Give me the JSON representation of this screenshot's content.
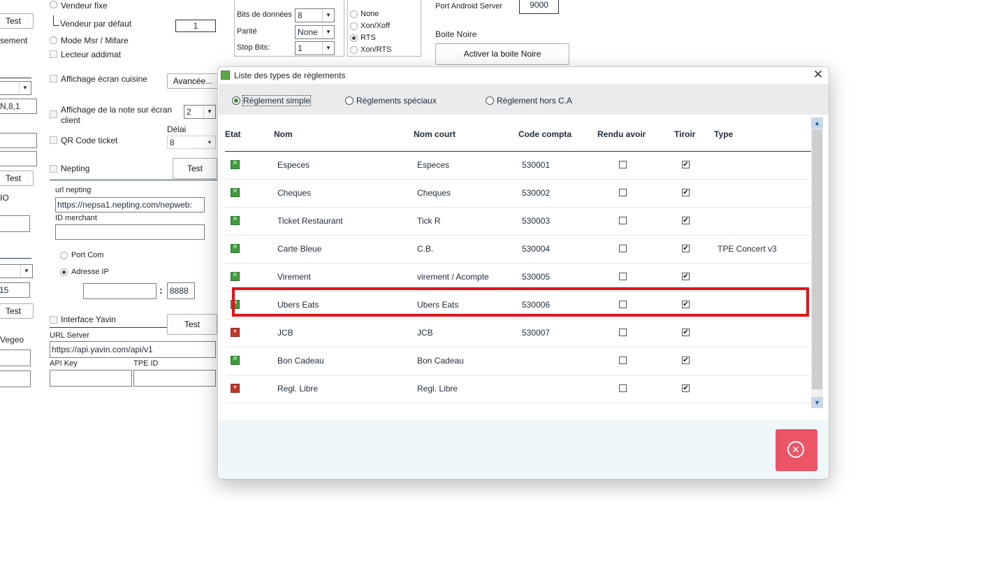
{
  "background": {
    "test_label": "Test",
    "vendeur_fixe": "Vendeur fixe",
    "vendeur_par_defaut": "Vendeur par défaut",
    "vendeur_par_defaut_value": "1",
    "sement": "sement",
    "mode_msr": "Mode Msr / Mifare",
    "lecteur_addimat": "Lecteur addimat",
    "affichage_cuisine": "Affichage écran cuisine",
    "avancee_button": "Avancée...",
    "n81": "N,8,1",
    "affichage_note": "Affichage de la note sur écran client",
    "affichage_note_value": "2",
    "delai_label": "Délai",
    "delai_value": "8",
    "qr_code": "QR Code ticket",
    "nepting": "Nepting",
    "url_nepting_label": "url nepting",
    "url_nepting_value": "https://nepsa1.nepting.com/nepweb:",
    "id_merchant_label": "ID merchant",
    "port_com": "Port Com",
    "adresse_ip": "Adresse IP",
    "port_value": "8888",
    "io_text": "IO",
    "value_15": "15",
    "interface_yavin": "Interface Yavin",
    "url_server_label": "URL Server",
    "url_server_value": "https://api.yavin.com/api/v1",
    "api_key_label": "API Key",
    "tpe_id_label": "TPE ID",
    "vegeo": "Vegeo",
    "bits_label": "Bits de données",
    "bits_value": "8",
    "parite_label": "Parité",
    "parite_value": "None",
    "stop_bits_label": "Stop Bits:",
    "stop_bits_value": "1",
    "flow_none": "None",
    "flow_xon": "Xon/Xoff",
    "flow_rts": "RTS",
    "flow_xon_rts": "Xon/RTS",
    "port_android_label": "Port Android Server",
    "port_android_value": "9000",
    "boite_noire_title": "Boite Noire",
    "activer_boite_noire": "Activer la boite Noire"
  },
  "dialog": {
    "title": "Liste des types de règlements",
    "close_glyph": "✕",
    "options": [
      {
        "label": "Règlement simple",
        "selected": true
      },
      {
        "label": "Réglements spéciaux",
        "selected": false
      },
      {
        "label": "Règlement hors C.A",
        "selected": false
      }
    ],
    "columns": {
      "etat": "Etat",
      "nom": "Nom",
      "nom_court": "Nom court",
      "code_compta": "Code compta",
      "rendu_avoir": "Rendu avoir",
      "tiroir": "Tiroir",
      "type": "Type"
    },
    "rows": [
      {
        "etat": "active",
        "nom": "Especes",
        "nom_court": "Especes",
        "code": "530001",
        "rendu_avoir": false,
        "tiroir": true,
        "type": ""
      },
      {
        "etat": "active",
        "nom": "Cheques",
        "nom_court": "Cheques",
        "code": "530002",
        "rendu_avoir": false,
        "tiroir": true,
        "type": ""
      },
      {
        "etat": "active",
        "nom": "Ticket Restaurant",
        "nom_court": "Tick R",
        "code": "530003",
        "rendu_avoir": false,
        "tiroir": true,
        "type": ""
      },
      {
        "etat": "active",
        "nom": "Carte Bleue",
        "nom_court": "C.B.",
        "code": "530004",
        "rendu_avoir": false,
        "tiroir": true,
        "type": "TPE Concert v3"
      },
      {
        "etat": "active",
        "nom": "Virement",
        "nom_court": "virement / Acompte",
        "code": "530005",
        "rendu_avoir": false,
        "tiroir": true,
        "type": ""
      },
      {
        "etat": "active",
        "nom": "Ubers Eats",
        "nom_court": "Ubers Eats",
        "code": "530006",
        "rendu_avoir": false,
        "tiroir": true,
        "type": ""
      },
      {
        "etat": "inactive",
        "nom": "JCB",
        "nom_court": "JCB",
        "code": "530007",
        "rendu_avoir": false,
        "tiroir": true,
        "type": ""
      },
      {
        "etat": "active",
        "nom": "Bon Cadeau",
        "nom_court": "Bon Cadeau",
        "code": "",
        "rendu_avoir": false,
        "tiroir": true,
        "type": ""
      },
      {
        "etat": "inactive",
        "nom": "Regl. Libre",
        "nom_court": "Regl. Libre",
        "code": "",
        "rendu_avoir": false,
        "tiroir": true,
        "type": ""
      }
    ],
    "highlight_color": "#e0141b",
    "cancel_color": "#eb5566",
    "cancel_icon": "close-circle-icon"
  }
}
